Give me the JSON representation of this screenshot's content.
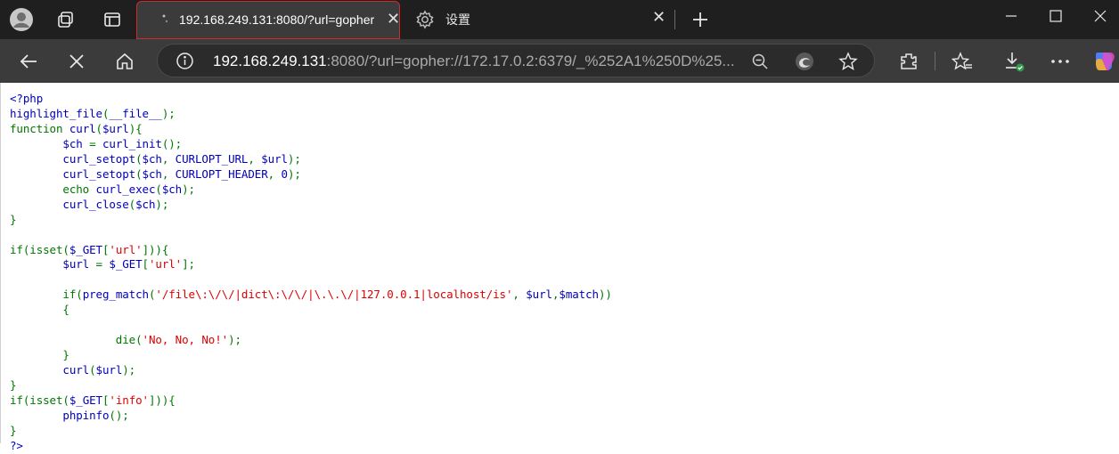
{
  "browser": {
    "tabs": [
      {
        "title": "192.168.249.131:8080/?url=gopher",
        "active": true
      },
      {
        "title": "设置",
        "active": false
      }
    ],
    "address": {
      "host": "192.168.249.131",
      "rest": ":8080/?url=gopher://172.17.0.2:6379/_%252A1%250D%25..."
    },
    "accent": "#d22b2b",
    "icons": [
      "profile-icon",
      "workspaces-icon",
      "tab-actions-icon",
      "loading-icon",
      "settings-gear-icon",
      "close-icon",
      "new-tab-icon",
      "minimize-icon",
      "maximize-icon",
      "window-close-icon",
      "back-icon",
      "stop-icon",
      "home-icon",
      "info-icon",
      "zoom-icon",
      "edge-icon",
      "favorite-icon",
      "extensions-icon",
      "favorites-icon",
      "downloads-icon",
      "more-icon",
      "copilot-icon"
    ]
  },
  "code": {
    "colors": {
      "html": "#0000BB",
      "keyword": "#007700",
      "string": "#DD0000"
    },
    "lines": [
      [
        [
          "h",
          "<?php"
        ]
      ],
      [
        [
          "h",
          "highlight_file"
        ],
        [
          "k",
          "("
        ],
        [
          "h",
          "__file__"
        ],
        [
          "k",
          ");"
        ]
      ],
      [
        [
          "k",
          "function "
        ],
        [
          "h",
          "curl"
        ],
        [
          "k",
          "("
        ],
        [
          "h",
          "$url"
        ],
        [
          "k",
          "){"
        ]
      ],
      [
        [
          "h",
          "        $ch "
        ],
        [
          "k",
          "= "
        ],
        [
          "h",
          "curl_init"
        ],
        [
          "k",
          "();"
        ]
      ],
      [
        [
          "h",
          "        curl_setopt"
        ],
        [
          "k",
          "("
        ],
        [
          "h",
          "$ch"
        ],
        [
          "k",
          ", "
        ],
        [
          "h",
          "CURLOPT_URL"
        ],
        [
          "k",
          ", "
        ],
        [
          "h",
          "$url"
        ],
        [
          "k",
          ");"
        ]
      ],
      [
        [
          "h",
          "        curl_setopt"
        ],
        [
          "k",
          "("
        ],
        [
          "h",
          "$ch"
        ],
        [
          "k",
          ", "
        ],
        [
          "h",
          "CURLOPT_HEADER"
        ],
        [
          "k",
          ", "
        ],
        [
          "h",
          "0"
        ],
        [
          "k",
          ");"
        ]
      ],
      [
        [
          "k",
          "        echo "
        ],
        [
          "h",
          "curl_exec"
        ],
        [
          "k",
          "("
        ],
        [
          "h",
          "$ch"
        ],
        [
          "k",
          ");"
        ]
      ],
      [
        [
          "h",
          "        curl_close"
        ],
        [
          "k",
          "("
        ],
        [
          "h",
          "$ch"
        ],
        [
          "k",
          ");"
        ]
      ],
      [
        [
          "k",
          "}"
        ]
      ],
      [
        [
          "k",
          ""
        ]
      ],
      [
        [
          "k",
          "if(isset("
        ],
        [
          "h",
          "$_GET"
        ],
        [
          "k",
          "["
        ],
        [
          "s",
          "'url'"
        ],
        [
          "k",
          "])){"
        ]
      ],
      [
        [
          "h",
          "        $url "
        ],
        [
          "k",
          "= "
        ],
        [
          "h",
          "$_GET"
        ],
        [
          "k",
          "["
        ],
        [
          "s",
          "'url'"
        ],
        [
          "k",
          "];"
        ]
      ],
      [
        [
          "k",
          ""
        ]
      ],
      [
        [
          "k",
          "        if("
        ],
        [
          "h",
          "preg_match"
        ],
        [
          "k",
          "("
        ],
        [
          "s",
          "'/file\\:\\/\\/|dict\\:\\/\\/|\\.\\.\\/|127.0.0.1|localhost/is'"
        ],
        [
          "k",
          ", "
        ],
        [
          "h",
          "$url"
        ],
        [
          "k",
          ","
        ],
        [
          "h",
          "$match"
        ],
        [
          "k",
          "))"
        ]
      ],
      [
        [
          "k",
          "        {"
        ]
      ],
      [
        [
          "k",
          ""
        ]
      ],
      [
        [
          "k",
          "                die("
        ],
        [
          "s",
          "'No, No, No!'"
        ],
        [
          "k",
          ");"
        ]
      ],
      [
        [
          "k",
          "        }"
        ]
      ],
      [
        [
          "h",
          "        curl"
        ],
        [
          "k",
          "("
        ],
        [
          "h",
          "$url"
        ],
        [
          "k",
          ");"
        ]
      ],
      [
        [
          "k",
          "}"
        ]
      ],
      [
        [
          "k",
          "if(isset("
        ],
        [
          "h",
          "$_GET"
        ],
        [
          "k",
          "["
        ],
        [
          "s",
          "'info'"
        ],
        [
          "k",
          "])){"
        ]
      ],
      [
        [
          "h",
          "        phpinfo"
        ],
        [
          "k",
          "();"
        ]
      ],
      [
        [
          "k",
          "}"
        ]
      ],
      [
        [
          "h",
          "?>"
        ]
      ]
    ]
  }
}
